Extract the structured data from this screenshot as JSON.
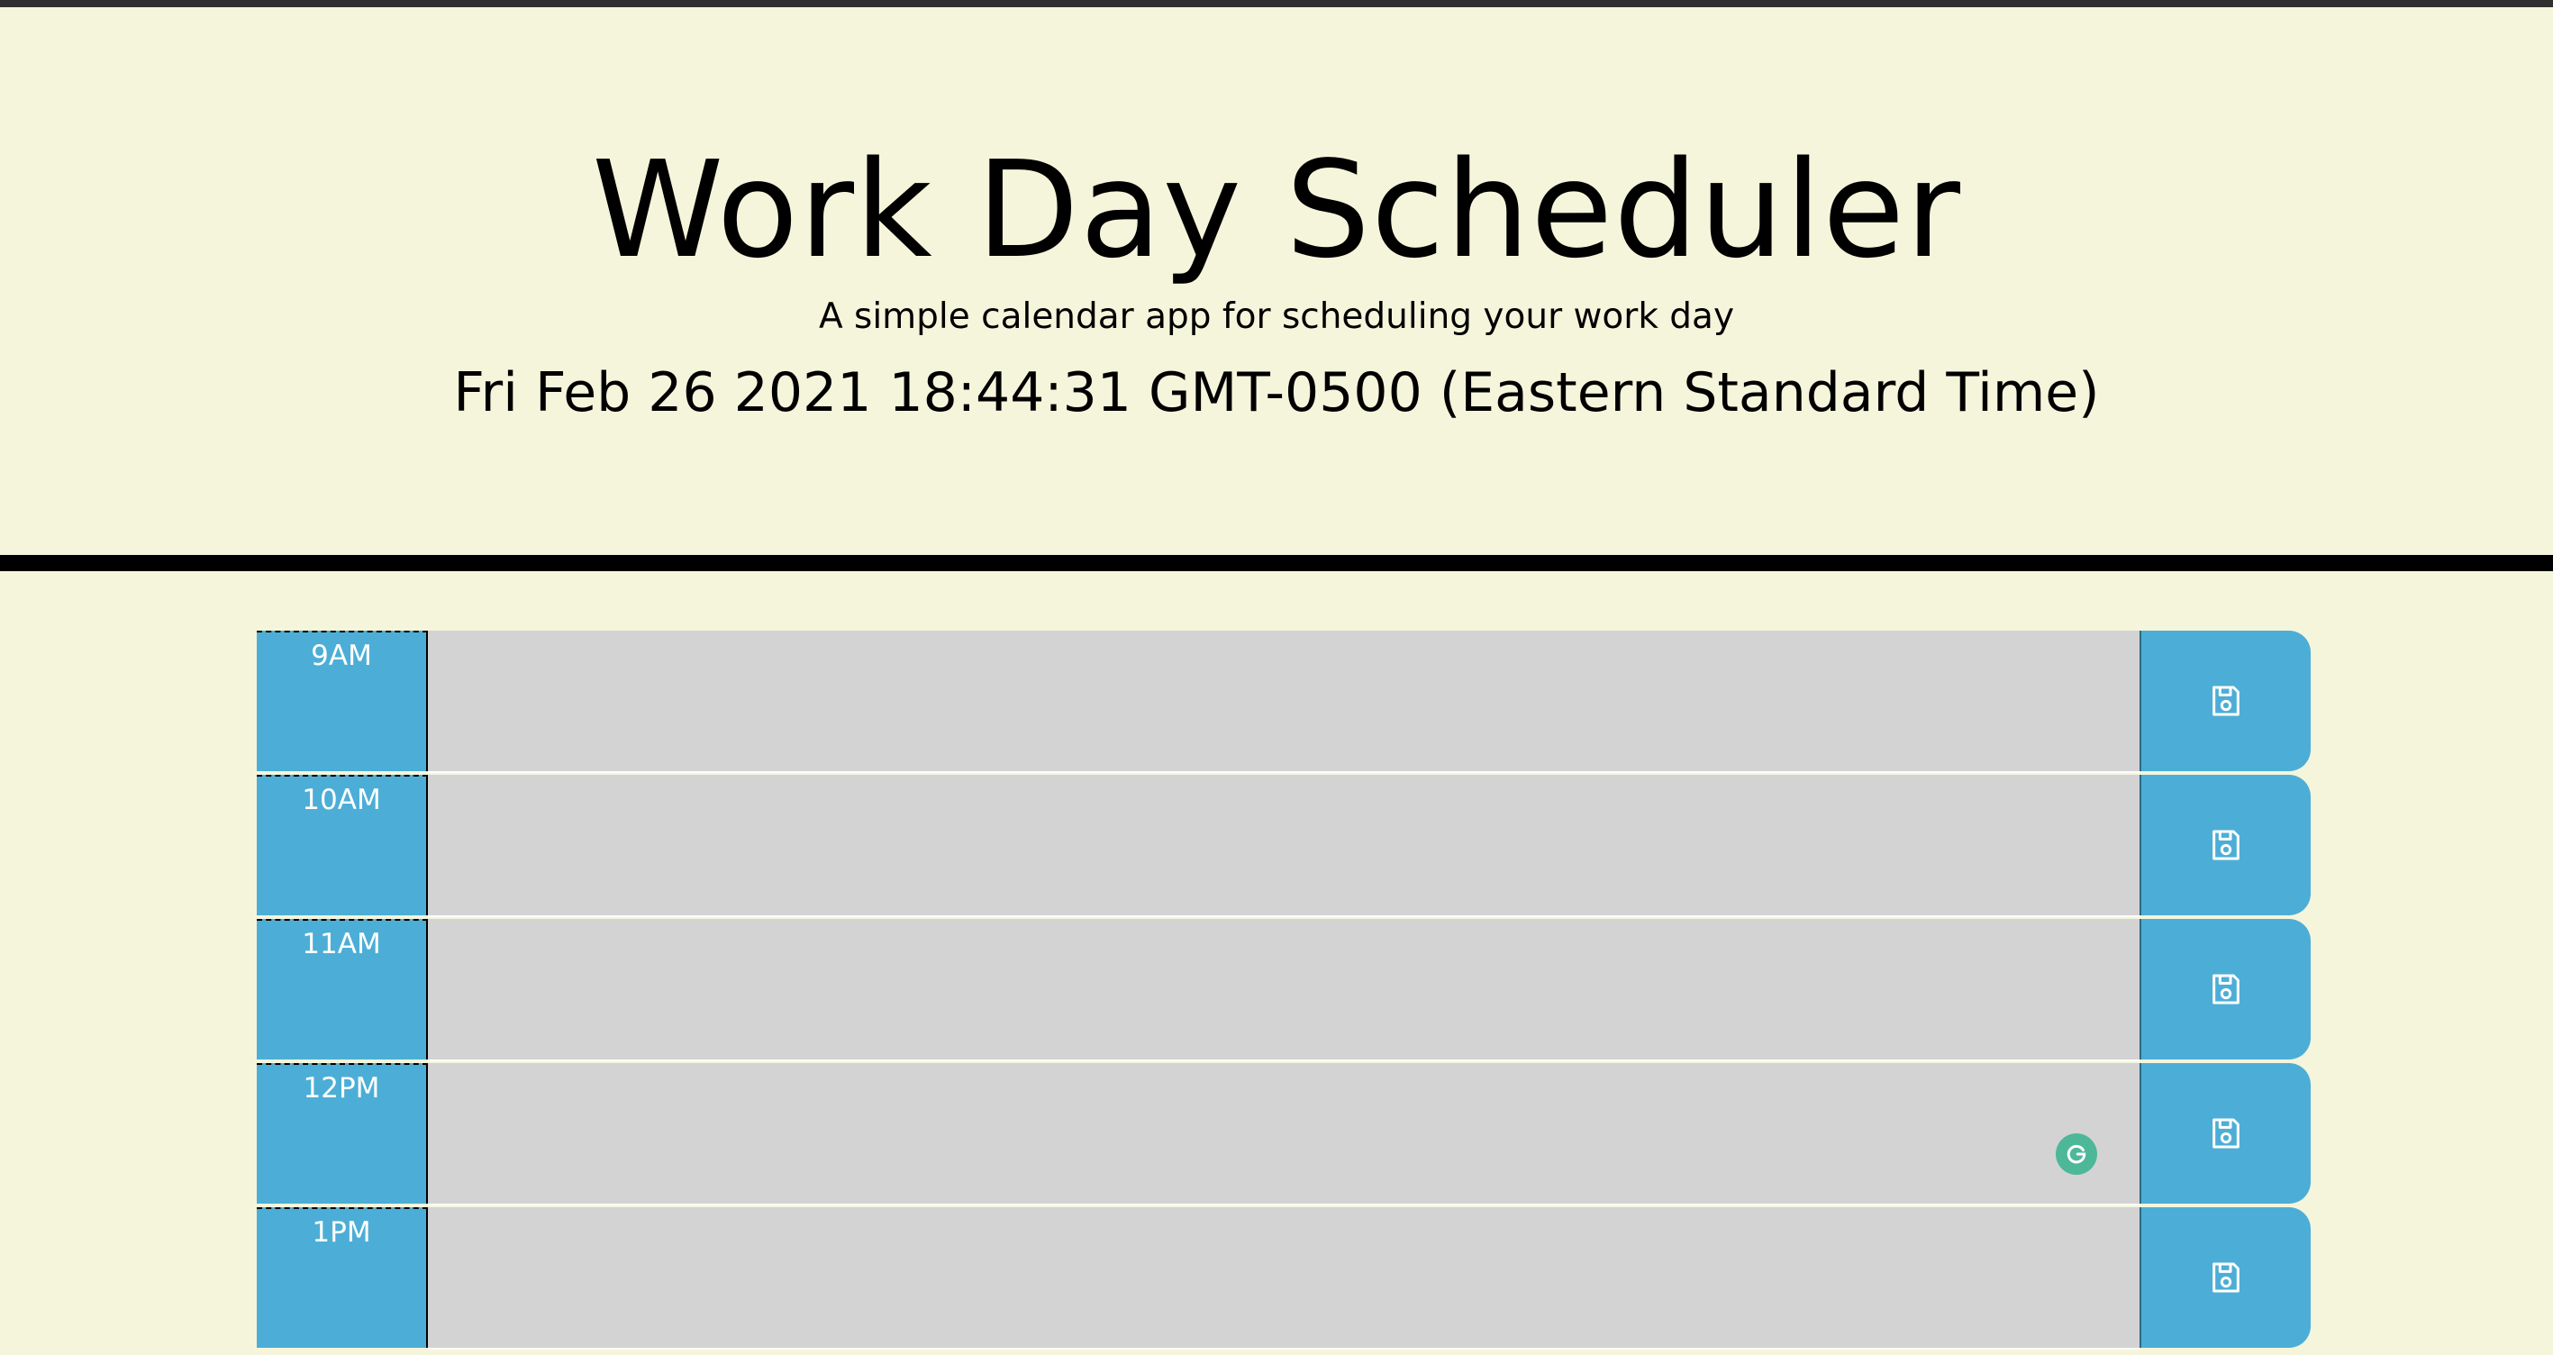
{
  "header": {
    "title": "Work Day Scheduler",
    "lead": "A simple calendar app for scheduling your work day",
    "current_day": "Fri Feb 26 2021 18:44:31 GMT-0500 (Eastern Standard Time)"
  },
  "colors": {
    "background": "#f5f5dc",
    "hour_block": "#4caed6",
    "save_button": "#4caed6",
    "past_row": "#d3d3d3",
    "divider": "#000000",
    "grammarly_badge": "#4cb897"
  },
  "time_blocks": [
    {
      "hour": "9AM",
      "description": "",
      "save_icon": "floppy-disk-icon"
    },
    {
      "hour": "10AM",
      "description": "",
      "save_icon": "floppy-disk-icon"
    },
    {
      "hour": "11AM",
      "description": "",
      "save_icon": "floppy-disk-icon"
    },
    {
      "hour": "12PM",
      "description": "",
      "save_icon": "floppy-disk-icon"
    },
    {
      "hour": "1PM",
      "description": "",
      "save_icon": "floppy-disk-icon"
    }
  ],
  "overlay": {
    "badge_icon": "grammarly-icon"
  }
}
